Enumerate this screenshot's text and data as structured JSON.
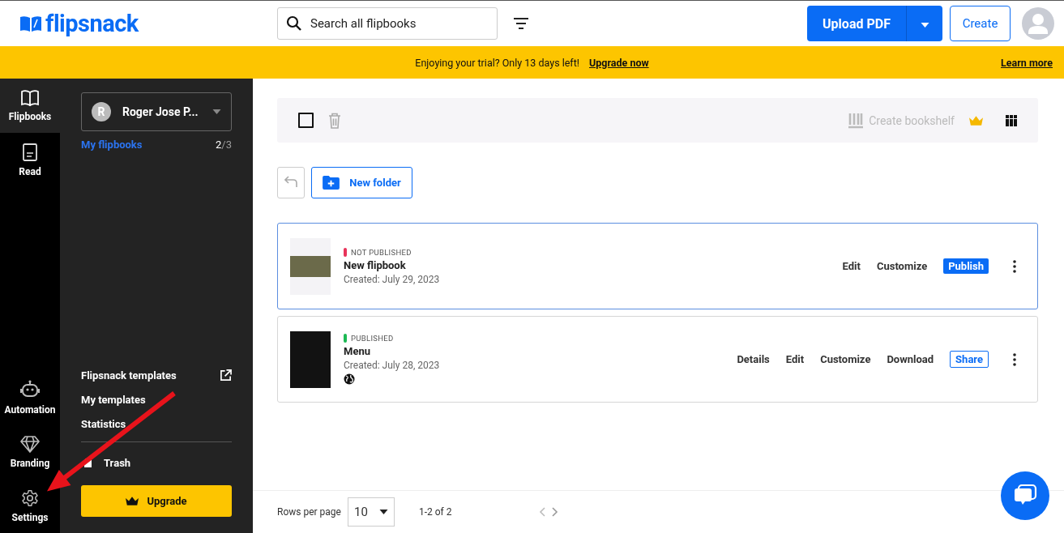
{
  "header": {
    "logo": "flipsnack",
    "search": {
      "placeholder": "Search all flipbooks"
    },
    "upload_button": "Upload PDF",
    "create_button": "Create"
  },
  "banner": {
    "message": "Enjoying your trial? Only 13 days left!",
    "link": "Upgrade now",
    "learn_more": "Learn more"
  },
  "rail": {
    "top": [
      {
        "label": "Flipbooks",
        "selected": true
      },
      {
        "label": "Read",
        "selected": false
      }
    ],
    "bottom": [
      {
        "label": "Automation",
        "selected": false
      },
      {
        "label": "Branding",
        "selected": false
      },
      {
        "label": "Settings",
        "selected": false
      }
    ]
  },
  "panel": {
    "account": {
      "initial": "R",
      "name": "Roger Jose P..."
    },
    "folder": {
      "label": "My flipbooks",
      "count": "2",
      "limit": "/3",
      "selected": true
    },
    "links": [
      {
        "label": "Flipsnack templates",
        "external": true
      },
      {
        "label": "My templates",
        "external": false
      },
      {
        "label": "Statistics",
        "external": false
      }
    ],
    "trash": "Trash",
    "upgrade": "Upgrade"
  },
  "toolbar": {
    "select_all_checked": false,
    "create_bookshelf": "Create bookshelf",
    "new_folder": "New folder"
  },
  "flipbooks": [
    {
      "status": "NOT PUBLISHED",
      "color": "#e8335a",
      "title": "New flipbook",
      "created": "Created: July 29, 2023",
      "public": false,
      "selected": true,
      "actions": [
        {
          "label": "Edit",
          "kind": "text"
        },
        {
          "label": "Customize",
          "kind": "text"
        },
        {
          "label": "Publish",
          "kind": "primary"
        }
      ]
    },
    {
      "status": "PUBLISHED",
      "color": "#1db954",
      "title": "Menu",
      "created": "Created: July 28, 2023",
      "public": true,
      "selected": false,
      "actions": [
        {
          "label": "Details",
          "kind": "text"
        },
        {
          "label": "Edit",
          "kind": "text"
        },
        {
          "label": "Customize",
          "kind": "text"
        },
        {
          "label": "Download",
          "kind": "text"
        },
        {
          "label": "Share",
          "kind": "outline"
        }
      ]
    }
  ],
  "pagination": {
    "rows_label": "Rows per page",
    "rows": "10",
    "range": "1-2 of 2"
  }
}
